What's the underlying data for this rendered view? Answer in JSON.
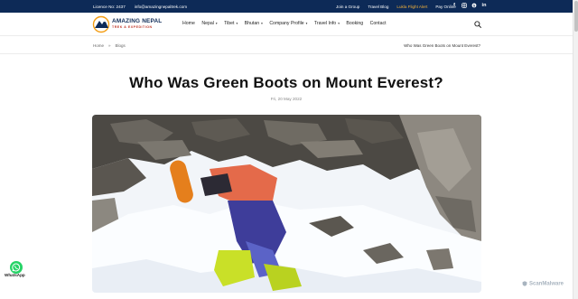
{
  "topbar": {
    "licence": "Licence No: 2437",
    "email": "info@amazingnepaltrek.com",
    "links": [
      "Join a Group",
      "Travel Blog",
      "Lukla Flight Alert",
      "Pay Online"
    ],
    "social_icons": [
      "facebook-icon",
      "instagram-icon",
      "skype-icon",
      "linkedin-icon"
    ],
    "highlight_color": "#f4b23b",
    "bg_color": "#0d2a57"
  },
  "logo": {
    "title": "AMAZING NEPAL",
    "subtitle": "TREK & EXPEDITION"
  },
  "nav": {
    "items": [
      {
        "label": "Home",
        "dropdown": false
      },
      {
        "label": "Nepal",
        "dropdown": true
      },
      {
        "label": "Tibet",
        "dropdown": true
      },
      {
        "label": "Bhutan",
        "dropdown": true
      },
      {
        "label": "Company Profile",
        "dropdown": true
      },
      {
        "label": "Travel Info",
        "dropdown": true
      },
      {
        "label": "Booking",
        "dropdown": false
      },
      {
        "label": "Contact",
        "dropdown": false
      }
    ],
    "caret": "▾"
  },
  "breadcrumb": {
    "items": [
      "Home",
      "Blogs"
    ],
    "separator": "»",
    "current": "Who Was Green Boots on Mount Everest?"
  },
  "article": {
    "title": "Who Was Green Boots on Mount Everest?",
    "date": "Fri, 20 May 2022"
  },
  "whatsapp": {
    "label": "WhatsApp"
  },
  "watermark": {
    "text": "ScanMalware"
  }
}
